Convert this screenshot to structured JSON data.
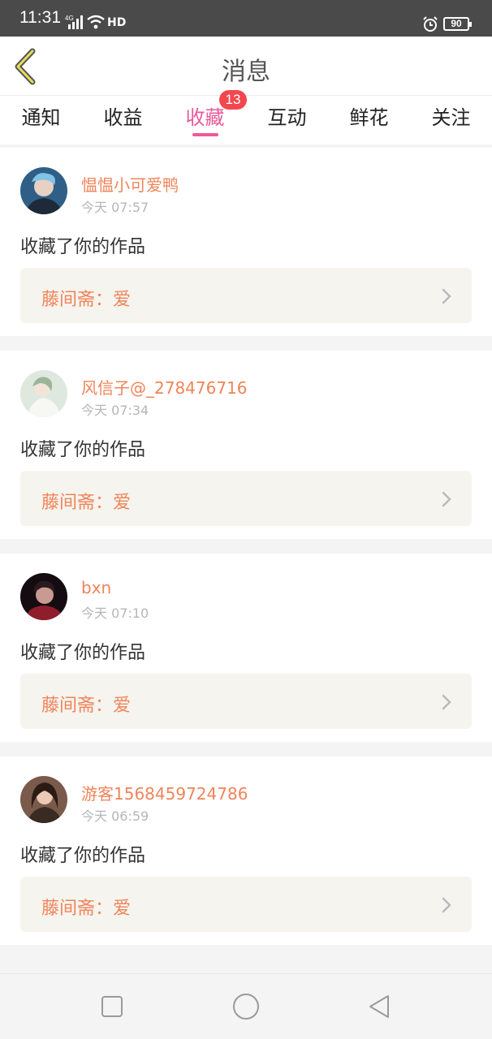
{
  "status_bar": {
    "time": "11:31",
    "network": "4G",
    "hd": "HD",
    "battery": "90"
  },
  "header": {
    "title": "消息"
  },
  "tabs": [
    {
      "label": "通知",
      "active": false
    },
    {
      "label": "收益",
      "active": false
    },
    {
      "label": "收藏",
      "active": true,
      "badge": "13"
    },
    {
      "label": "互动",
      "active": false
    },
    {
      "label": "鲜花",
      "active": false
    },
    {
      "label": "关注",
      "active": false
    }
  ],
  "messages": [
    {
      "user": "愠愠小可爱鸭",
      "time": "今天 07:57",
      "action": "收藏了你的作品",
      "work_title": "藤间斋：爱",
      "avatar": "avatar-1"
    },
    {
      "user": "风信子@_278476716",
      "time": "今天 07:34",
      "action": "收藏了你的作品",
      "work_title": "藤间斋：爱",
      "avatar": "avatar-2"
    },
    {
      "user": "bxn",
      "time": "今天 07:10",
      "action": "收藏了你的作品",
      "work_title": "藤间斋：爱",
      "avatar": "avatar-3"
    },
    {
      "user": "游客1568459724786",
      "time": "今天 06:59",
      "action": "收藏了你的作品",
      "work_title": "藤间斋：爱",
      "avatar": "avatar-4"
    }
  ],
  "colors": {
    "accent": "#ea5a9a",
    "username": "#f0845a",
    "badge": "#f2474e",
    "card_bg": "#f5f4ee"
  },
  "icons": {
    "back": "chevron-left-icon",
    "chevron": "chevron-right-icon",
    "nav_square": "square-icon",
    "nav_home": "circle-icon",
    "nav_back": "triangle-icon"
  }
}
